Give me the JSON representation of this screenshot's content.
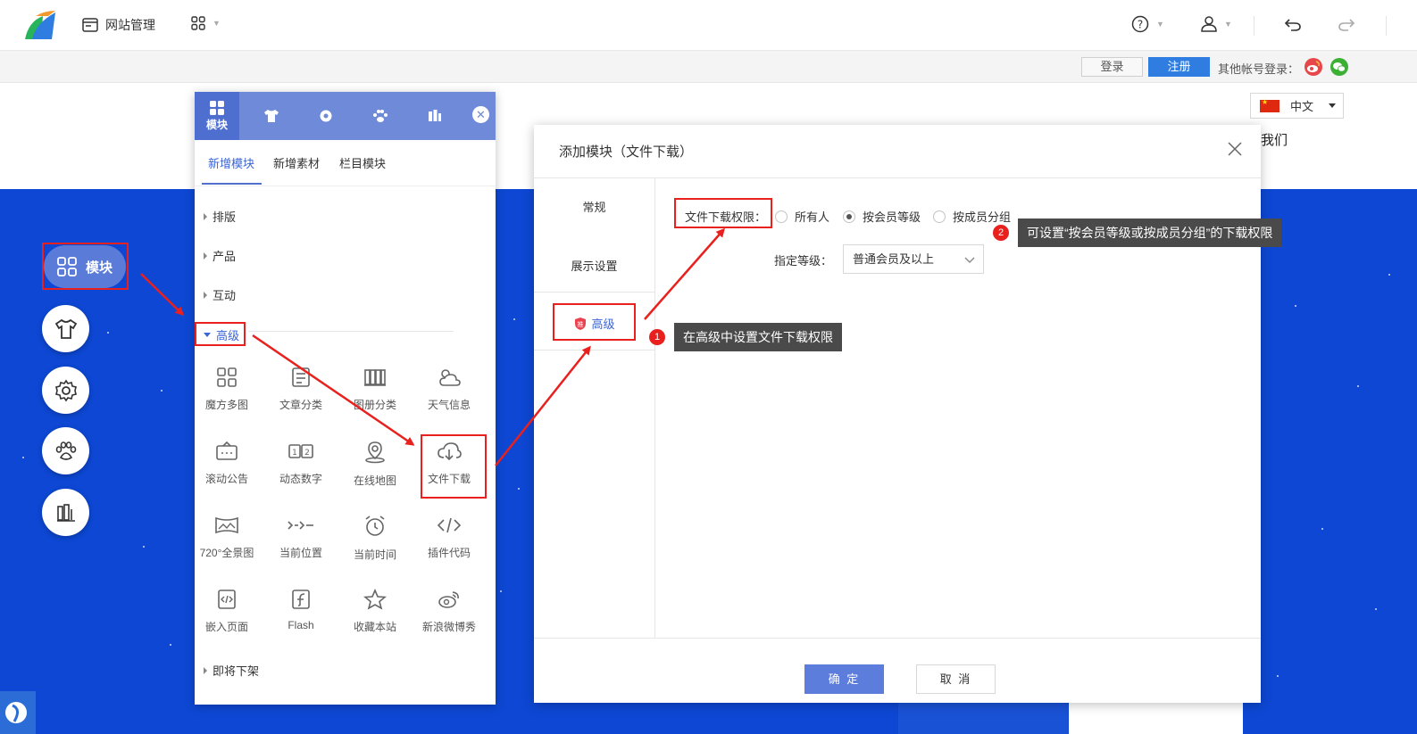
{
  "topbar": {
    "site_manage_label": "网站管理"
  },
  "subheader": {
    "login_label": "登录",
    "register_label": "注册",
    "other_login_label": "其他帐号登录："
  },
  "site": {
    "language_label": "中文",
    "about_text": "我们"
  },
  "toolbar": {
    "module_label": "模块"
  },
  "panel": {
    "active_tab_label": "模块",
    "subtabs": [
      "新增模块",
      "新增素材",
      "栏目模块"
    ],
    "categories": [
      "排版",
      "产品",
      "互动",
      "高级",
      "即将下架"
    ],
    "items": [
      "魔方多图",
      "文章分类",
      "图册分类",
      "天气信息",
      "滚动公告",
      "动态数字",
      "在线地图",
      "文件下载",
      "720°全景图",
      "当前位置",
      "当前时间",
      "插件代码",
      "嵌入页面",
      "Flash",
      "收藏本站",
      "新浪微博秀"
    ]
  },
  "dialog": {
    "title": "添加模块（文件下载）",
    "side_items": [
      "常规",
      "展示设置",
      "高级"
    ],
    "permission_label": "文件下载权限：",
    "options": [
      "所有人",
      "按会员等级",
      "按成员分组"
    ],
    "level_label": "指定等级：",
    "level_value": "普通会员及以上",
    "ok_label": "确 定",
    "cancel_label": "取 消"
  },
  "annotations": [
    {
      "num": "1",
      "text": "在高级中设置文件下载权限"
    },
    {
      "num": "2",
      "text": "可设置“按会员等级或按成员分组”的下载权限"
    }
  ],
  "colors": {
    "accent": "#5470cf",
    "site_blue": "#0d47d3",
    "annotation_red": "#e8211e"
  }
}
